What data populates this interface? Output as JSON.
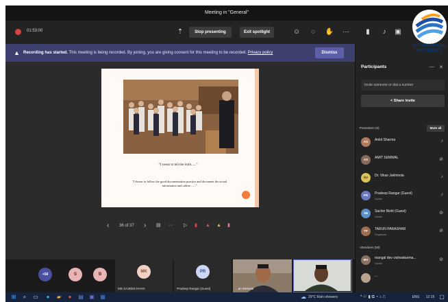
{
  "window": {
    "title": "Meeting in \"General\""
  },
  "toolbar": {
    "timer": "01:53:00",
    "stop_presenting_label": "Stop presenting",
    "exit_spotlight_label": "Exit spotlight",
    "more_label": "···"
  },
  "logo": {
    "text": "UTTARANCHAL UNIVERSITY"
  },
  "banner": {
    "title": "Recording has started.",
    "message": "This meeting is being recorded. By joining, you are giving consent for this meeting to be recorded.",
    "privacy_link": "Privacy policy",
    "dismiss_label": "Dismiss"
  },
  "slide": {
    "quote1": "\"I swear to tell the truth......\"",
    "quote2": "\"I Swear to follow the good documentation practice and document the actual information and online.......\""
  },
  "slide_controls": {
    "prev": "‹",
    "page": "36 of 37",
    "next": "›"
  },
  "video_strip": {
    "more_badge": "+58",
    "avatars": [
      "S",
      "B"
    ],
    "tiles": [
      {
        "initials": "MK",
        "name": "MD SAJEED KHAN"
      },
      {
        "initials": "PR",
        "name": "Pradeep Rangar (Guest)"
      }
    ],
    "video_names": [
      "...an Semwal",
      ""
    ]
  },
  "participants": {
    "title": "Participants",
    "invite_placeholder": "Invite someone or dial a number",
    "share_invite_label": "Share invite",
    "presenters_label": "Presenters (6)",
    "mute_all_label": "Mute all",
    "presenters": [
      {
        "name": "Ankit Sharma",
        "initials": "AS",
        "role": ""
      },
      {
        "name": "AMIT SEMWAL",
        "initials": "AS",
        "role": ""
      },
      {
        "name": "Dr. Vikas Jakhmola",
        "initials": "DV",
        "role": ""
      },
      {
        "name": "Pradeep Rangar (Guest)",
        "initials": "PR",
        "role": "Guest"
      },
      {
        "name": "Sachin Bisht (Guest)",
        "initials": "SB",
        "role": "Guest"
      },
      {
        "name": "TARUN PARASHAR",
        "initials": "TP",
        "role": "Organizer"
      }
    ],
    "attendees_label": "Attendees (58)",
    "attendees": [
      {
        "name": "mangal dev vishwakarma...",
        "initials": "MV",
        "role": "Guest"
      },
      {
        "name": "...",
        "initials": "",
        "role": ""
      }
    ]
  },
  "taskbar": {
    "weather": "29°C  Rain showers",
    "lang": "ENG",
    "time": "12:15"
  },
  "colors": {
    "banner": "#3d3f6e",
    "accent": "#5b5fa8",
    "record": "#d64545",
    "slide_dot": "#f07d3b"
  }
}
